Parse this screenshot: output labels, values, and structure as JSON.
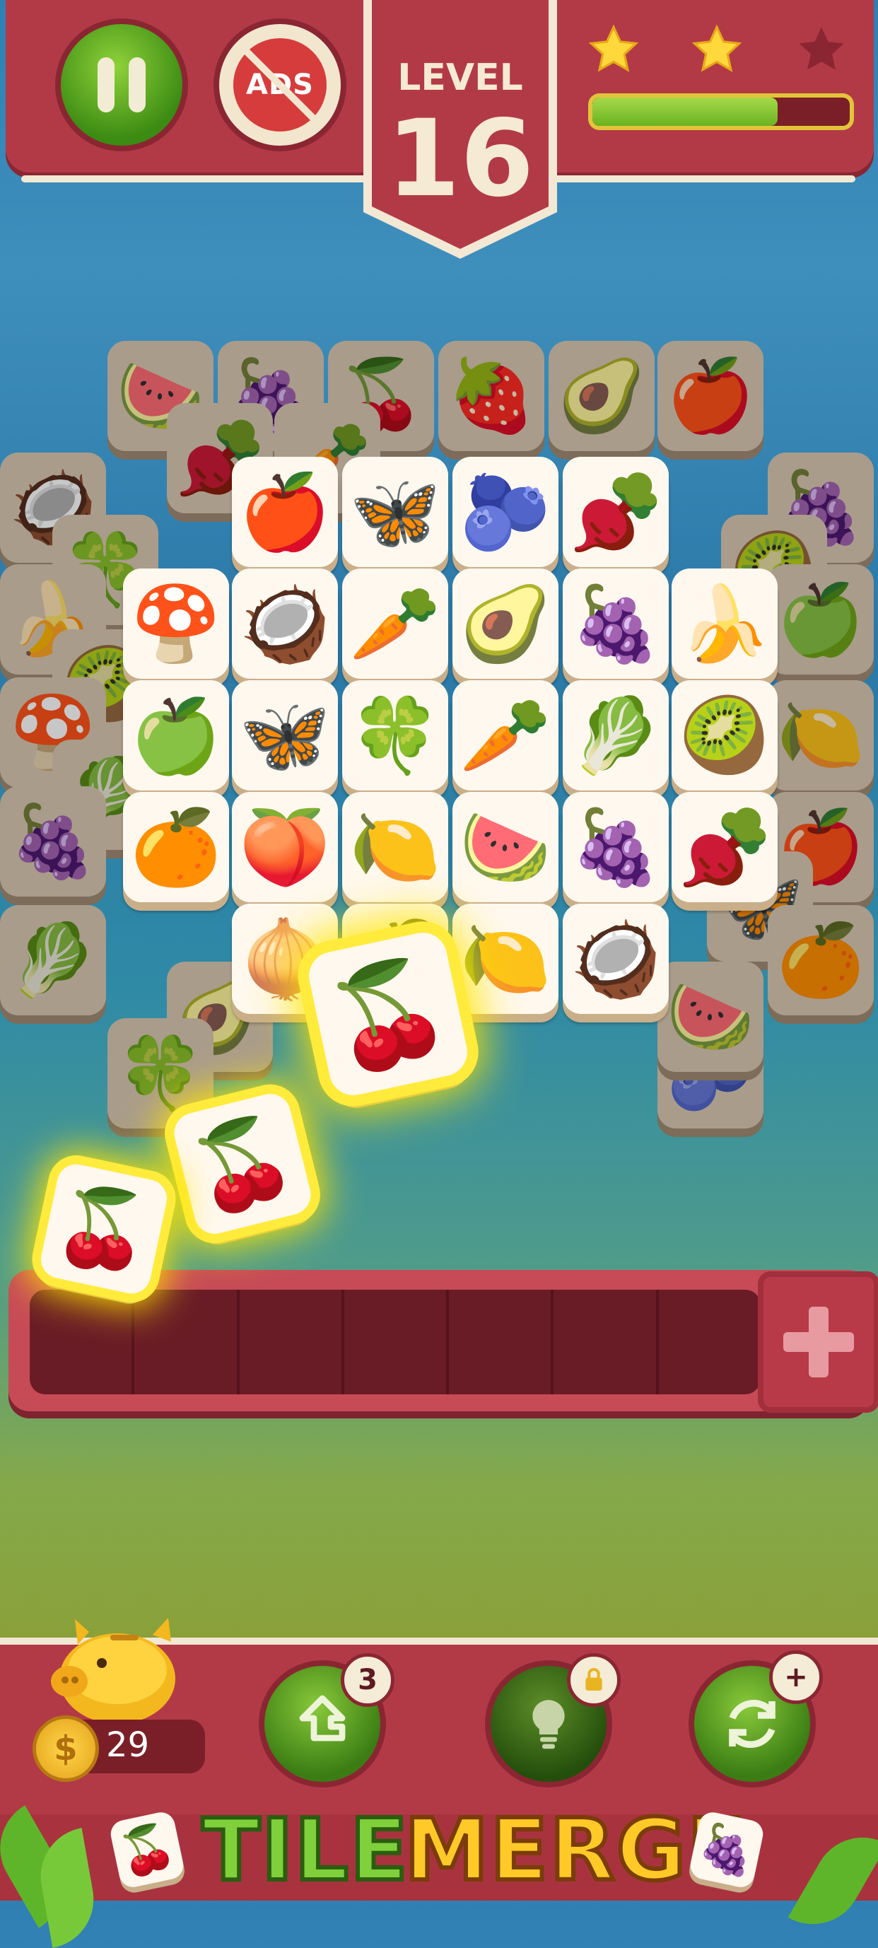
{
  "header": {
    "pause_label": "Pause",
    "no_ads_label": "ADS",
    "level_label": "LEVEL",
    "level_number": "16",
    "stars_earned": 2,
    "stars_total": 3,
    "progress_fraction": 0.72
  },
  "colors": {
    "primary_red": "#b23a47",
    "cream": "#f3e8d4",
    "green_button": "#4d9a1c",
    "gold": "#e3c43a"
  },
  "board": {
    "back_tiles": [
      {
        "icon": "watermelon",
        "glyph": "🍉"
      },
      {
        "icon": "grapes",
        "glyph": "🍇"
      },
      {
        "icon": "cherries",
        "glyph": "🍒"
      },
      {
        "icon": "strawberry",
        "glyph": "🍓"
      },
      {
        "icon": "avocado",
        "glyph": "🥑"
      },
      {
        "icon": "apple",
        "glyph": "🍎"
      },
      {
        "icon": "coconut",
        "glyph": "🥥"
      },
      {
        "icon": "radish",
        "glyph": "🫜"
      },
      {
        "icon": "carrot",
        "glyph": "🥕"
      },
      {
        "icon": "grapes",
        "glyph": "🍇"
      },
      {
        "icon": "clover",
        "glyph": "🍀"
      },
      {
        "icon": "kiwi",
        "glyph": "🥝"
      },
      {
        "icon": "banana",
        "glyph": "🍌"
      },
      {
        "icon": "green-apple",
        "glyph": "🍏"
      },
      {
        "icon": "kiwi",
        "glyph": "🥝"
      },
      {
        "icon": "mushroom",
        "glyph": "🍄"
      },
      {
        "icon": "cabbage",
        "glyph": "🥬"
      },
      {
        "icon": "grapes",
        "glyph": "🍇"
      },
      {
        "icon": "lemon",
        "glyph": "🍋"
      },
      {
        "icon": "pomegranate",
        "glyph": "🍎"
      },
      {
        "icon": "butterfly",
        "glyph": "🦋"
      },
      {
        "icon": "orange",
        "glyph": "🍊"
      },
      {
        "icon": "cabbage",
        "glyph": "🥬"
      },
      {
        "icon": "avocado",
        "glyph": "🥑"
      },
      {
        "icon": "clover",
        "glyph": "🍀"
      },
      {
        "icon": "blueberry",
        "glyph": "🫐"
      },
      {
        "icon": "watermelon",
        "glyph": "🍉"
      }
    ],
    "top_tiles": [
      {
        "icon": "pomegranate",
        "glyph": "🍎"
      },
      {
        "icon": "butterfly",
        "glyph": "🦋"
      },
      {
        "icon": "blueberry",
        "glyph": "🫐"
      },
      {
        "icon": "radish",
        "glyph": "🫜"
      },
      {
        "icon": "mushroom",
        "glyph": "🍄"
      },
      {
        "icon": "coconut",
        "glyph": "🥥"
      },
      {
        "icon": "carrot",
        "glyph": "🥕"
      },
      {
        "icon": "avocado",
        "glyph": "🥑"
      },
      {
        "icon": "grapes",
        "glyph": "🍇"
      },
      {
        "icon": "banana",
        "glyph": "🍌"
      },
      {
        "icon": "green-apple",
        "glyph": "🍏"
      },
      {
        "icon": "butterfly",
        "glyph": "🦋"
      },
      {
        "icon": "clover",
        "glyph": "🍀"
      },
      {
        "icon": "carrot",
        "glyph": "🥕"
      },
      {
        "icon": "cabbage",
        "glyph": "🥬"
      },
      {
        "icon": "kiwi",
        "glyph": "🥝"
      },
      {
        "icon": "orange",
        "glyph": "🍊"
      },
      {
        "icon": "peach",
        "glyph": "🍑"
      },
      {
        "icon": "lemon",
        "glyph": "🍋"
      },
      {
        "icon": "watermelon",
        "glyph": "🍉"
      },
      {
        "icon": "grapes",
        "glyph": "🍇"
      },
      {
        "icon": "radish",
        "glyph": "🫜"
      },
      {
        "icon": "mangosteen",
        "glyph": "🧅"
      },
      {
        "icon": "orange",
        "glyph": "🍊"
      },
      {
        "icon": "lemon",
        "glyph": "🍋"
      },
      {
        "icon": "coconut",
        "glyph": "🥥"
      }
    ],
    "moving_tiles": [
      {
        "icon": "cherries",
        "glyph": "🍒"
      },
      {
        "icon": "cherries",
        "glyph": "🍒"
      },
      {
        "icon": "cherries",
        "glyph": "🍒"
      }
    ]
  },
  "tray": {
    "slots": 7,
    "add_slot_label": "+"
  },
  "footer": {
    "coins": "29",
    "coin_symbol": "$",
    "undo_count": "3",
    "hint_locked": true,
    "shuffle_badge": "+",
    "logo_word_1": "TILE",
    "logo_word_2": "MERGE"
  }
}
